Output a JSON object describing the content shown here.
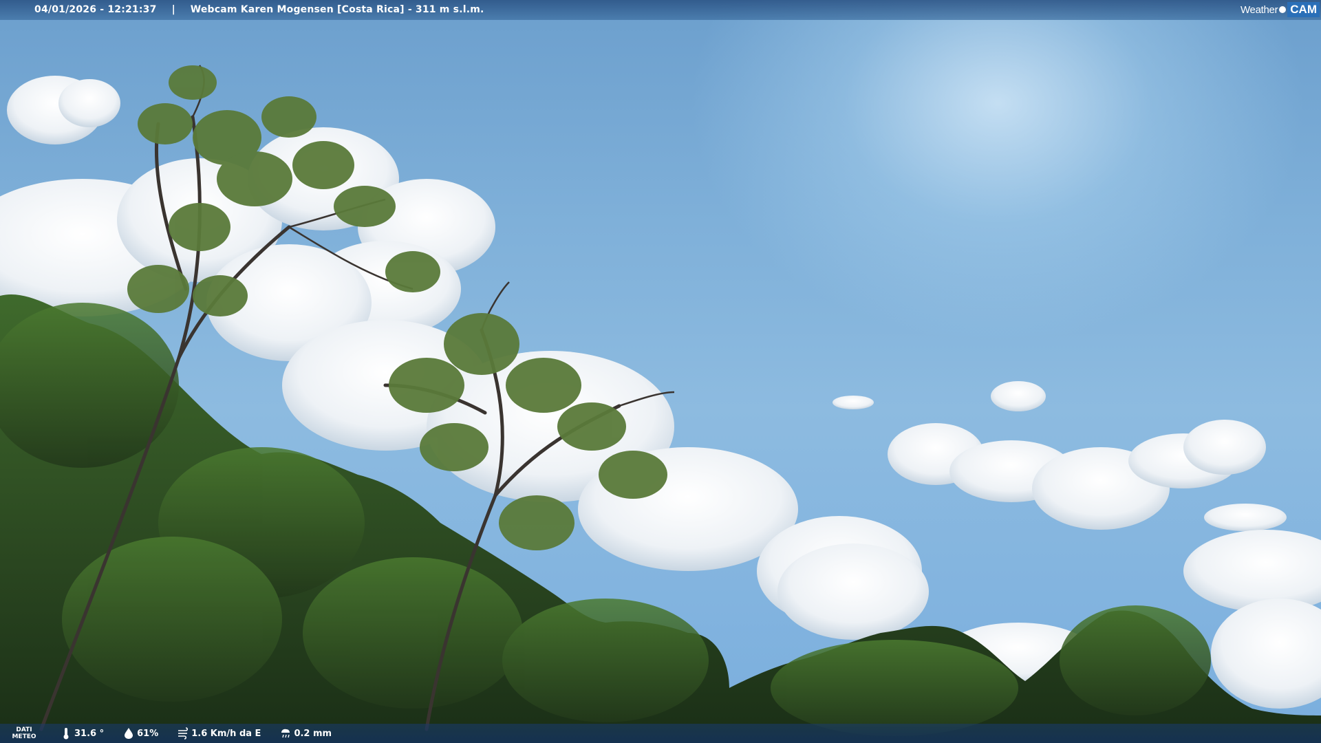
{
  "header": {
    "datetime": "04/01/2026 - 12:21:37",
    "separator": "|",
    "title": "Webcam Karen Mogensen [Costa Rica]  - 311 m s.l.m."
  },
  "logo": {
    "weather": "Weather",
    "cam": "CAM"
  },
  "footer": {
    "dati_line1": "DATI",
    "dati_line2": "METEO",
    "temperature": "31.6 °",
    "humidity": "61%",
    "wind": "1.6 Km/h da E",
    "rain": "0.2 mm"
  },
  "colors": {
    "sky": "#7fb0d9",
    "cloud": "#f4f7fa",
    "foliage": "#2c4a22",
    "bar": "#1e4a80"
  },
  "icons": {
    "temperature": "thermometer-icon",
    "humidity": "drop-icon",
    "wind": "wind-icon",
    "rain": "rain-icon"
  }
}
